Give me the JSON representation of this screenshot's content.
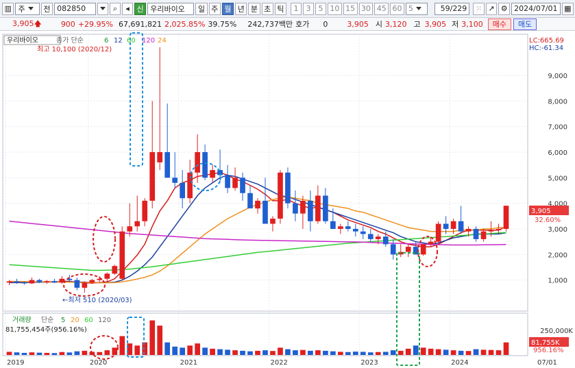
{
  "toolbar": {
    "tab1": "주",
    "tab2": "전",
    "code": "082850",
    "name_badge": "신",
    "stock_name": "우리바이오",
    "periods": [
      "일",
      "주",
      "월",
      "년",
      "분",
      "초",
      "틱"
    ],
    "selected_period": "월",
    "intervals": [
      "1",
      "3",
      "5",
      "10",
      "15",
      "30",
      "45",
      "60"
    ],
    "interval_value": "5",
    "page": "59/229",
    "date": "2024/07/01"
  },
  "quote": {
    "price": "3,905",
    "change": "900",
    "change_pct": "+29.95%",
    "volume": "67,691,821",
    "volume_ratio": "2,025.85%",
    "turnover": "39.75%",
    "amount": "242,737백만",
    "hoga_label": "호가",
    "hoga_value": "0",
    "current": "3,905",
    "open_label": "시",
    "open": "3,120",
    "high_label": "고",
    "high": "3,905",
    "low_label": "저",
    "low": "3,100",
    "buy_label": "매수",
    "sell_label": "매도"
  },
  "legend": {
    "stock": "우리바이오",
    "ma_label": "종가 단순",
    "ma_periods": [
      "6",
      "12",
      "60",
      "120",
      "24"
    ],
    "ma_colors": [
      "#1c8f2f",
      "#1a3fa0",
      "#33cc33",
      "#c826c8",
      "#f0901c"
    ],
    "lc": "LC:665.69",
    "hc": "HC:-61.34",
    "high_note": "최고 10,100 (2020/12)",
    "low_note": "←최저 510 (2020/03)"
  },
  "vol_legend": {
    "label": "거래량",
    "ma_label": "단순",
    "periods": [
      "5",
      "20",
      "60",
      "120"
    ],
    "summary": "81,755,454주(956.16%)"
  },
  "side_labels": {
    "price": "3,905",
    "pct": "32.60%",
    "vol": "81,755K",
    "vol_pct": "956.16%"
  },
  "chart_data": {
    "type": "candlestick",
    "period": "monthly",
    "ylim": [
      0,
      10500
    ],
    "yticks": [
      "1,000",
      "2,000",
      "3,000",
      "4,000",
      "5,000",
      "6,000",
      "7,000",
      "8,000",
      "9,000"
    ],
    "vol_yticks": [
      "250,000K"
    ],
    "x_labels": [
      "2019",
      "2020",
      "2021",
      "2022",
      "2023",
      "2024",
      "07/01"
    ],
    "candles": [
      {
        "o": 900,
        "h": 1000,
        "l": 800,
        "c": 950
      },
      {
        "o": 950,
        "h": 1050,
        "l": 850,
        "c": 900
      },
      {
        "o": 900,
        "h": 950,
        "l": 820,
        "c": 870
      },
      {
        "o": 870,
        "h": 1100,
        "l": 850,
        "c": 1000
      },
      {
        "o": 1000,
        "h": 1050,
        "l": 880,
        "c": 920
      },
      {
        "o": 920,
        "h": 1000,
        "l": 850,
        "c": 960
      },
      {
        "o": 960,
        "h": 1050,
        "l": 880,
        "c": 900
      },
      {
        "o": 900,
        "h": 1150,
        "l": 850,
        "c": 1050
      },
      {
        "o": 1050,
        "h": 1200,
        "l": 950,
        "c": 1000
      },
      {
        "o": 1000,
        "h": 1100,
        "l": 600,
        "c": 700
      },
      {
        "o": 700,
        "h": 950,
        "l": 510,
        "c": 900
      },
      {
        "o": 900,
        "h": 1050,
        "l": 850,
        "c": 1000
      },
      {
        "o": 1000,
        "h": 1150,
        "l": 900,
        "c": 1050
      },
      {
        "o": 1050,
        "h": 1300,
        "l": 950,
        "c": 1250
      },
      {
        "o": 1250,
        "h": 1600,
        "l": 1200,
        "c": 1550
      },
      {
        "o": 1050,
        "h": 3100,
        "l": 1000,
        "c": 2900
      },
      {
        "o": 2900,
        "h": 4000,
        "l": 2700,
        "c": 3100
      },
      {
        "o": 3100,
        "h": 4300,
        "l": 2900,
        "c": 3300
      },
      {
        "o": 3300,
        "h": 4200,
        "l": 3100,
        "c": 4100
      },
      {
        "o": 4100,
        "h": 8000,
        "l": 3800,
        "c": 6000
      },
      {
        "o": 5600,
        "h": 10100,
        "l": 5300,
        "c": 6000
      },
      {
        "o": 6000,
        "h": 7900,
        "l": 5000,
        "c": 5000
      },
      {
        "o": 5000,
        "h": 6000,
        "l": 4600,
        "c": 4800
      },
      {
        "o": 4800,
        "h": 5300,
        "l": 3800,
        "c": 4200
      },
      {
        "o": 4200,
        "h": 5700,
        "l": 4000,
        "c": 5200
      },
      {
        "o": 5200,
        "h": 6700,
        "l": 4800,
        "c": 6000
      },
      {
        "o": 6000,
        "h": 6300,
        "l": 4900,
        "c": 5000
      },
      {
        "o": 5000,
        "h": 5500,
        "l": 4800,
        "c": 5300
      },
      {
        "o": 5300,
        "h": 6100,
        "l": 4800,
        "c": 5100
      },
      {
        "o": 5100,
        "h": 5500,
        "l": 4400,
        "c": 4600
      },
      {
        "o": 4600,
        "h": 5400,
        "l": 4500,
        "c": 5000
      },
      {
        "o": 5000,
        "h": 5200,
        "l": 4100,
        "c": 4400
      },
      {
        "o": 4400,
        "h": 4700,
        "l": 3900,
        "c": 3800
      },
      {
        "o": 3800,
        "h": 4200,
        "l": 3600,
        "c": 4100
      },
      {
        "o": 4100,
        "h": 5000,
        "l": 3500,
        "c": 3200
      },
      {
        "o": 3200,
        "h": 3500,
        "l": 2900,
        "c": 3400
      },
      {
        "o": 3400,
        "h": 5300,
        "l": 3200,
        "c": 5200
      },
      {
        "o": 5200,
        "h": 5400,
        "l": 3800,
        "c": 4000
      },
      {
        "o": 4000,
        "h": 4500,
        "l": 3300,
        "c": 3600
      },
      {
        "o": 3600,
        "h": 4300,
        "l": 3000,
        "c": 4100
      },
      {
        "o": 4100,
        "h": 4500,
        "l": 2900,
        "c": 3300
      },
      {
        "o": 3300,
        "h": 4700,
        "l": 3200,
        "c": 4300
      },
      {
        "o": 4300,
        "h": 4600,
        "l": 3200,
        "c": 3300
      },
      {
        "o": 3300,
        "h": 3800,
        "l": 3000,
        "c": 3000
      },
      {
        "o": 3000,
        "h": 3200,
        "l": 2800,
        "c": 3100
      },
      {
        "o": 3100,
        "h": 3300,
        "l": 2900,
        "c": 3000
      },
      {
        "o": 3000,
        "h": 3200,
        "l": 2700,
        "c": 2900
      },
      {
        "o": 2900,
        "h": 3100,
        "l": 2600,
        "c": 2800
      },
      {
        "o": 2800,
        "h": 3000,
        "l": 2500,
        "c": 2600
      },
      {
        "o": 2600,
        "h": 2800,
        "l": 2400,
        "c": 2700
      },
      {
        "o": 2700,
        "h": 2900,
        "l": 2300,
        "c": 2400
      },
      {
        "o": 2400,
        "h": 2600,
        "l": 1800,
        "c": 2000
      },
      {
        "o": 2000,
        "h": 2400,
        "l": 1900,
        "c": 2100
      },
      {
        "o": 2100,
        "h": 2400,
        "l": 1900,
        "c": 2300
      },
      {
        "o": 2300,
        "h": 2500,
        "l": 2000,
        "c": 2000
      },
      {
        "o": 2000,
        "h": 2400,
        "l": 1950,
        "c": 2400
      },
      {
        "o": 2400,
        "h": 2700,
        "l": 2300,
        "c": 2500
      },
      {
        "o": 2500,
        "h": 3300,
        "l": 2400,
        "c": 3200
      },
      {
        "o": 3200,
        "h": 3500,
        "l": 2800,
        "c": 3000
      },
      {
        "o": 3000,
        "h": 3400,
        "l": 2800,
        "c": 3300
      },
      {
        "o": 3300,
        "h": 3900,
        "l": 2800,
        "c": 2900
      },
      {
        "o": 2900,
        "h": 3100,
        "l": 2700,
        "c": 3000
      },
      {
        "o": 3000,
        "h": 3100,
        "l": 2500,
        "c": 2600
      },
      {
        "o": 2600,
        "h": 3000,
        "l": 2500,
        "c": 2900
      },
      {
        "o": 2900,
        "h": 3300,
        "l": 2700,
        "c": 2950
      },
      {
        "o": 2950,
        "h": 3200,
        "l": 2800,
        "c": 3000
      },
      {
        "o": 3000,
        "h": 3905,
        "l": 2900,
        "c": 3905
      }
    ],
    "volumes": [
      30,
      25,
      20,
      25,
      22,
      20,
      18,
      28,
      24,
      35,
      40,
      30,
      28,
      45,
      70,
      180,
      110,
      90,
      120,
      330,
      280,
      120,
      80,
      70,
      90,
      110,
      70,
      60,
      55,
      50,
      45,
      40,
      35,
      40,
      45,
      38,
      70,
      55,
      45,
      48,
      40,
      45,
      40,
      35,
      30,
      28,
      32,
      30,
      25,
      28,
      30,
      45,
      40,
      60,
      90,
      70,
      60,
      55,
      50,
      45,
      40,
      38,
      55,
      50,
      48,
      45,
      120
    ],
    "ma_lines": [
      {
        "name": "6",
        "color": "#d41c1c",
        "values": [
          900,
          905,
          900,
          920,
          930,
          935,
          930,
          940,
          950,
          920,
          890,
          880,
          900,
          930,
          1050,
          1350,
          1650,
          1980,
          2400,
          3100,
          3700,
          4100,
          4600,
          4800,
          4900,
          5050,
          5100,
          5150,
          5200,
          5100,
          4950,
          4850,
          4700,
          4550,
          4350,
          4100,
          4100,
          4150,
          4000,
          3900,
          3800,
          3850,
          3750,
          3650,
          3500,
          3350,
          3250,
          3150,
          3050,
          2900,
          2800,
          2650,
          2500,
          2400,
          2350,
          2300,
          2300,
          2400,
          2550,
          2700,
          2850,
          2950,
          2950,
          2950,
          2950,
          2950,
          3100
        ]
      },
      {
        "name": "12",
        "color": "#1a3fa0",
        "values": [
          900,
          900,
          905,
          910,
          915,
          920,
          925,
          925,
          930,
          925,
          915,
          905,
          900,
          900,
          920,
          1000,
          1150,
          1350,
          1600,
          1900,
          2300,
          2700,
          3100,
          3500,
          3900,
          4300,
          4600,
          4800,
          5000,
          5100,
          5050,
          4950,
          4850,
          4750,
          4600,
          4450,
          4300,
          4250,
          4150,
          4050,
          3950,
          3850,
          3750,
          3650,
          3550,
          3450,
          3350,
          3250,
          3150,
          3050,
          2950,
          2850,
          2700,
          2600,
          2500,
          2450,
          2400,
          2450,
          2550,
          2650,
          2700,
          2750,
          2800,
          2800,
          2800,
          2800,
          2850
        ]
      },
      {
        "name": "24",
        "color": "#f0901c",
        "values": [
          950,
          945,
          940,
          935,
          930,
          925,
          920,
          915,
          915,
          910,
          905,
          900,
          895,
          895,
          900,
          930,
          980,
          1040,
          1110,
          1200,
          1350,
          1550,
          1800,
          2050,
          2300,
          2550,
          2800,
          3000,
          3200,
          3400,
          3550,
          3700,
          3850,
          3950,
          4050,
          4150,
          4200,
          4250,
          4200,
          4150,
          4100,
          4000,
          3950,
          3900,
          3850,
          3800,
          3700,
          3650,
          3550,
          3450,
          3350,
          3250,
          3150,
          3050,
          3000,
          2950,
          2900,
          2900,
          2900,
          2900,
          2950,
          2950,
          2950,
          3000,
          3000,
          3050,
          3050
        ]
      },
      {
        "name": "60",
        "color": "#33cc33",
        "values": [
          1600,
          1580,
          1560,
          1540,
          1520,
          1500,
          1480,
          1460,
          1440,
          1420,
          1400,
          1380,
          1380,
          1385,
          1395,
          1410,
          1430,
          1460,
          1490,
          1520,
          1560,
          1600,
          1640,
          1680,
          1720,
          1760,
          1800,
          1840,
          1880,
          1920,
          1960,
          2000,
          2040,
          2080,
          2110,
          2140,
          2170,
          2200,
          2230,
          2260,
          2290,
          2320,
          2350,
          2380,
          2410,
          2440,
          2460,
          2480,
          2500,
          2520,
          2540,
          2560,
          2580,
          2600,
          2620,
          2640,
          2660,
          2680,
          2700,
          2720,
          2740,
          2760,
          2780,
          2800,
          2820,
          2840,
          2860
        ]
      },
      {
        "name": "120",
        "color": "#c826c8",
        "values": [
          3300,
          3270,
          3240,
          3210,
          3180,
          3150,
          3120,
          3090,
          3060,
          3030,
          3000,
          2970,
          2940,
          2910,
          2880,
          2850,
          2820,
          2800,
          2780,
          2760,
          2740,
          2720,
          2700,
          2680,
          2660,
          2640,
          2620,
          2610,
          2600,
          2590,
          2580,
          2570,
          2560,
          2555,
          2550,
          2545,
          2540,
          2535,
          2530,
          2525,
          2520,
          2515,
          2510,
          2505,
          2500,
          2495,
          2490,
          2480,
          2470,
          2460,
          2450,
          2440,
          2430,
          2420,
          2410,
          2400,
          2390,
          2380,
          2375,
          2370,
          2370,
          2370,
          2370,
          2375,
          2380,
          2385,
          2390
        ]
      }
    ]
  }
}
